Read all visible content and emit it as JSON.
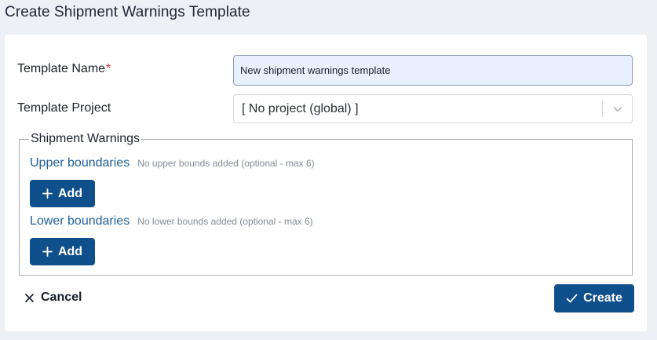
{
  "header": {
    "title": "Create Shipment Warnings Template"
  },
  "form": {
    "template_name": {
      "label": "Template Name",
      "required_marker": "*",
      "value": "New shipment warnings template"
    },
    "template_project": {
      "label": "Template Project",
      "selected": "[ No project (global) ]"
    }
  },
  "shipment_warnings": {
    "legend": "Shipment Warnings",
    "upper": {
      "title": "Upper boundaries",
      "note": "No upper bounds added (optional - max 6)",
      "add_label": "Add"
    },
    "lower": {
      "title": "Lower boundaries",
      "note": "No lower bounds added (optional - max 6)",
      "add_label": "Add"
    }
  },
  "actions": {
    "cancel_label": "Cancel",
    "create_label": "Create"
  },
  "icons": {
    "select": "chevron-down-icon",
    "add": "plus-icon",
    "cancel": "close-icon",
    "create": "check-icon"
  },
  "colors": {
    "primary": "#0f4f8b",
    "section_title": "#1f5f9a",
    "required": "#d0312d",
    "input_bg": "#e8f0fd",
    "page_bg": "#edf0f4"
  }
}
